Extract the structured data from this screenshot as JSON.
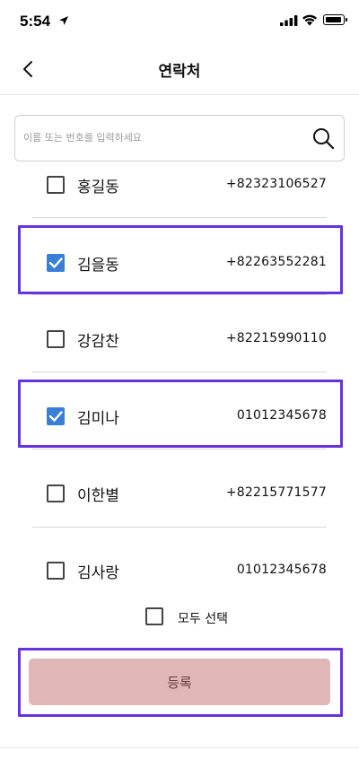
{
  "status_bar": {
    "time": "5:54",
    "icons": [
      "location-arrow-icon",
      "signal-icon",
      "wifi-icon",
      "battery-icon"
    ]
  },
  "nav": {
    "title": "연락처",
    "back_icon": "chevron-left-icon"
  },
  "search": {
    "placeholder": "이름 또는 번호를 입력하세요",
    "value": "",
    "icon": "search-icon"
  },
  "contacts": [
    {
      "name": "홍길동",
      "phone": "+82323106527",
      "checked": false
    },
    {
      "name": "김을동",
      "phone": "+82263552281",
      "checked": true
    },
    {
      "name": "강감찬",
      "phone": "+82215990110",
      "checked": false
    },
    {
      "name": "김미나",
      "phone": "01012345678",
      "checked": true
    },
    {
      "name": "이한별",
      "phone": "+82215771577",
      "checked": false
    },
    {
      "name": "김사랑",
      "phone": "01012345678",
      "checked": false
    }
  ],
  "select_all": {
    "label": "모두 선택",
    "checked": false
  },
  "register_button": {
    "label": "등록"
  },
  "colors": {
    "checkbox_checked": "#3a7fd5",
    "register_button_bg": "#dfb7b7",
    "register_button_text": "#6b3d3d",
    "highlight_border": "#6633dd"
  }
}
